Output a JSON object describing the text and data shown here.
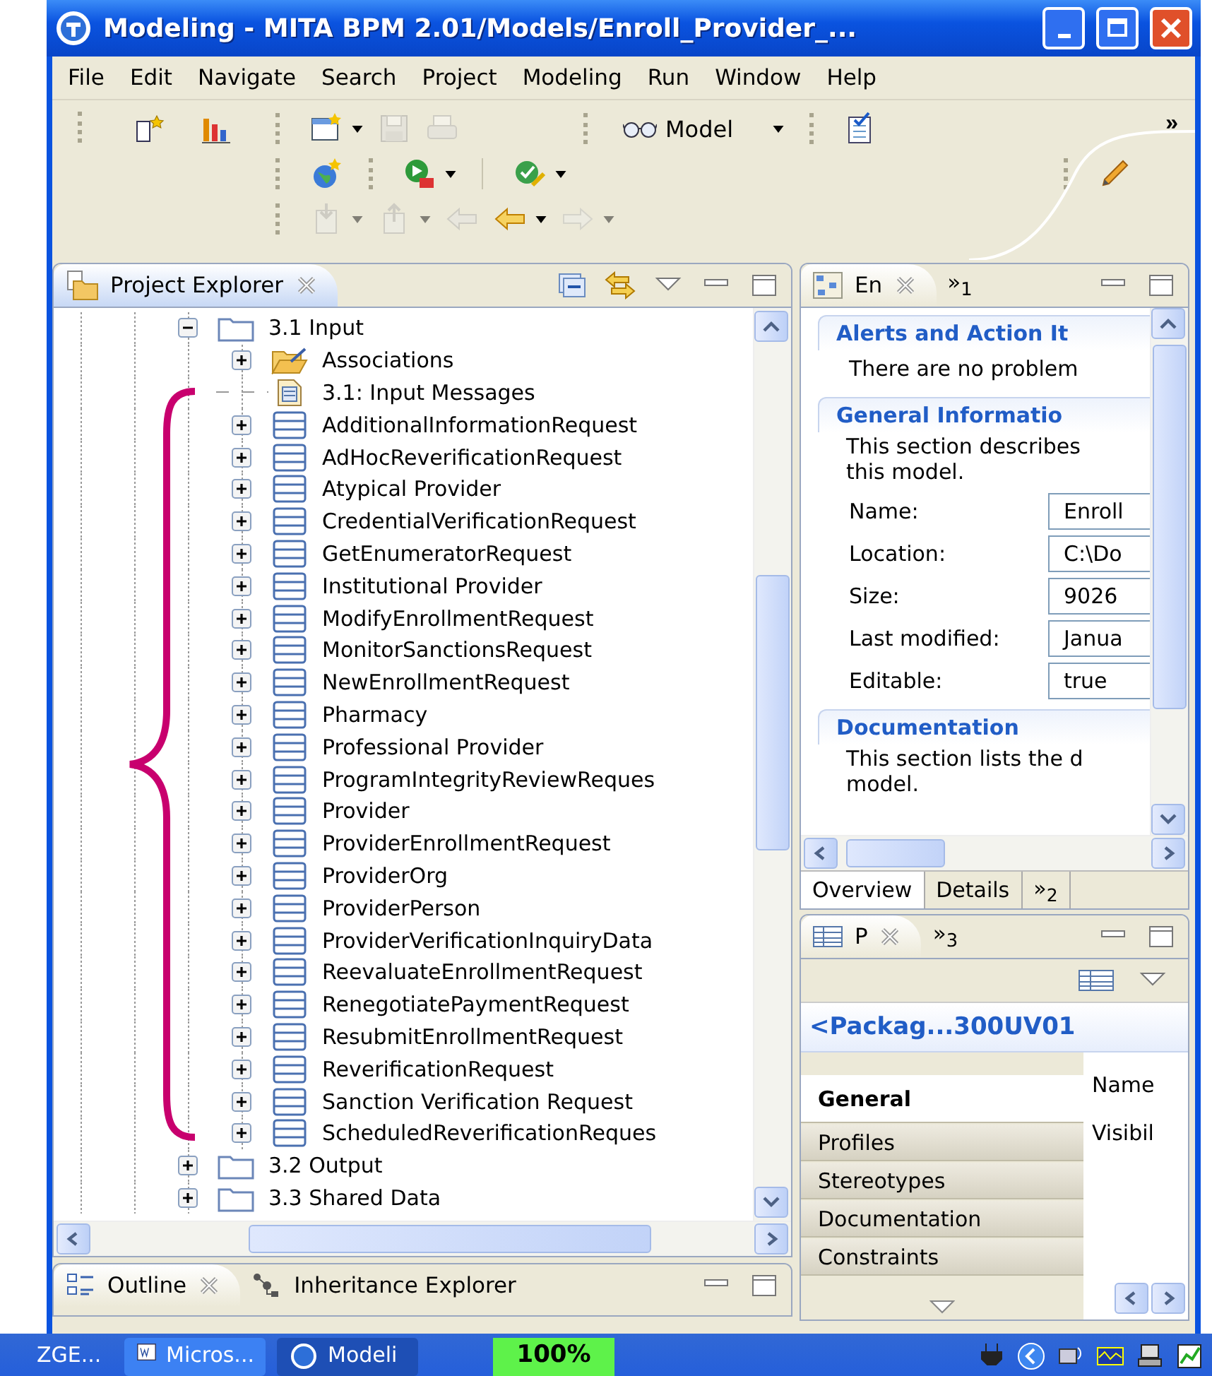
{
  "window": {
    "title": "Modeling - MITA BPM 2.01/Models/Enroll_Provider_..."
  },
  "menu": [
    "File",
    "Edit",
    "Navigate",
    "Search",
    "Project",
    "Modeling",
    "Run",
    "Window",
    "Help"
  ],
  "toolbar": {
    "overflow": "»",
    "perspective": {
      "label": "Model"
    },
    "rows": [
      [
        {
          "kind": "new-element",
          "disabled": false,
          "dropdown": false
        },
        {
          "kind": "chart",
          "disabled": false,
          "dropdown": false
        },
        {
          "kind": "new-file",
          "disabled": false,
          "dropdown": true
        },
        {
          "kind": "save",
          "disabled": true,
          "dropdown": false
        },
        {
          "kind": "print",
          "disabled": true,
          "dropdown": false
        },
        {
          "kind": "perspective",
          "disabled": false,
          "dropdown": true
        },
        {
          "kind": "task",
          "disabled": false,
          "dropdown": false
        }
      ],
      [
        {
          "kind": "globe",
          "disabled": false,
          "dropdown": false
        },
        {
          "kind": "run",
          "disabled": false,
          "dropdown": true
        },
        {
          "kind": "validate",
          "disabled": false,
          "dropdown": true
        },
        {
          "kind": "pen",
          "disabled": false,
          "dropdown": false
        }
      ],
      [
        {
          "kind": "import",
          "disabled": true,
          "dropdown": true
        },
        {
          "kind": "export",
          "disabled": true,
          "dropdown": true
        },
        {
          "kind": "back-edit",
          "disabled": true,
          "dropdown": false
        },
        {
          "kind": "back",
          "disabled": false,
          "dropdown": true
        },
        {
          "kind": "forward",
          "disabled": true,
          "dropdown": true
        }
      ]
    ]
  },
  "project_explorer": {
    "tab": {
      "label": "Project Explorer",
      "selected": true
    },
    "tree": [
      {
        "label": "3.1 Input",
        "kind": "folder",
        "expanded": true,
        "children": [
          {
            "label": "Associations",
            "kind": "open-folder",
            "expanded": false
          },
          {
            "label": "3.1: Input Messages",
            "kind": "document"
          },
          {
            "label": "AdditionalInformationRequest",
            "kind": "message",
            "expanded": false
          },
          {
            "label": "AdHocReverificationRequest",
            "kind": "message",
            "expanded": false
          },
          {
            "label": "Atypical Provider",
            "kind": "message",
            "expanded": false
          },
          {
            "label": "CredentialVerificationRequest",
            "kind": "message",
            "expanded": false
          },
          {
            "label": "GetEnumeratorRequest",
            "kind": "message",
            "expanded": false
          },
          {
            "label": "Institutional Provider",
            "kind": "message",
            "expanded": false
          },
          {
            "label": "ModifyEnrollmentRequest",
            "kind": "message",
            "expanded": false
          },
          {
            "label": "MonitorSanctionsRequest",
            "kind": "message",
            "expanded": false
          },
          {
            "label": "NewEnrollmentRequest",
            "kind": "message",
            "expanded": false
          },
          {
            "label": "Pharmacy",
            "kind": "message",
            "expanded": false
          },
          {
            "label": "Professional Provider",
            "kind": "message",
            "expanded": false
          },
          {
            "label": "ProgramIntegrityReviewReques",
            "kind": "message",
            "expanded": false
          },
          {
            "label": "Provider",
            "kind": "message",
            "expanded": false
          },
          {
            "label": "ProviderEnrollmentRequest",
            "kind": "message",
            "expanded": false
          },
          {
            "label": "ProviderOrg",
            "kind": "message",
            "expanded": false
          },
          {
            "label": "ProviderPerson",
            "kind": "message",
            "expanded": false
          },
          {
            "label": "ProviderVerificationInquiryData",
            "kind": "message",
            "expanded": false
          },
          {
            "label": "ReevaluateEnrollmentRequest",
            "kind": "message",
            "expanded": false
          },
          {
            "label": "RenegotiatePaymentRequest",
            "kind": "message",
            "expanded": false
          },
          {
            "label": "ResubmitEnrollmentRequest",
            "kind": "message",
            "expanded": false
          },
          {
            "label": "ReverificationRequest",
            "kind": "message",
            "expanded": false
          },
          {
            "label": "Sanction Verification Request",
            "kind": "message",
            "expanded": false
          },
          {
            "label": "ScheduledReverificationReques",
            "kind": "message",
            "expanded": false
          }
        ]
      },
      {
        "label": "3.2 Output",
        "kind": "folder",
        "expanded": false
      },
      {
        "label": "3.3 Shared Data",
        "kind": "folder",
        "expanded": false
      }
    ]
  },
  "outline_panel": {
    "tabs": [
      {
        "label": "Outline",
        "selected": true
      },
      {
        "label": "Inheritance Explorer",
        "selected": false
      }
    ]
  },
  "editor_panel": {
    "tabs": [
      {
        "label": "En",
        "selected": true
      },
      {
        "label": "»$_{1}$",
        "selected": false
      }
    ],
    "sections": [
      {
        "heading": "Alerts and Action It",
        "lines": [
          "There are no problem"
        ]
      },
      {
        "heading": "General Informatio",
        "lines": [
          "This section describes",
          "this model."
        ],
        "fields": [
          {
            "label": "Name:",
            "value": "Enroll"
          },
          {
            "label": "Location:",
            "value": "C:\\Do"
          },
          {
            "label": "Size:",
            "value": "9026"
          },
          {
            "label": "Last modified:",
            "value": "Janua"
          },
          {
            "label": "Editable:",
            "value": "true"
          }
        ]
      },
      {
        "heading": "Documentation",
        "lines": [
          "This section lists the d",
          "model."
        ]
      }
    ],
    "bottom_tabs": [
      {
        "label": "Overview",
        "selected": true
      },
      {
        "label": "Details",
        "selected": false
      },
      {
        "label": "»$_{2}$",
        "selected": false
      }
    ]
  },
  "properties_panel": {
    "tabs": [
      {
        "label": "P",
        "selected": true
      },
      {
        "label": "»$_{3}$",
        "selected": false
      }
    ],
    "title": "<Packag...300UV01",
    "categories": [
      {
        "label": "General",
        "selected": true
      },
      {
        "label": "Profiles",
        "selected": false
      },
      {
        "label": "Stereotypes",
        "selected": false
      },
      {
        "label": "Documentation",
        "selected": false
      },
      {
        "label": "Constraints",
        "selected": false
      }
    ],
    "field_labels": [
      "Name",
      "Visibil"
    ]
  },
  "taskbar": {
    "items": [
      {
        "label": "ZGE...",
        "kind": "plain",
        "selected": false
      },
      {
        "label": "Micros...",
        "kind": "word",
        "selected": false
      },
      {
        "label": "Modeli",
        "kind": "app",
        "selected": true
      }
    ],
    "zoom": "100%"
  }
}
